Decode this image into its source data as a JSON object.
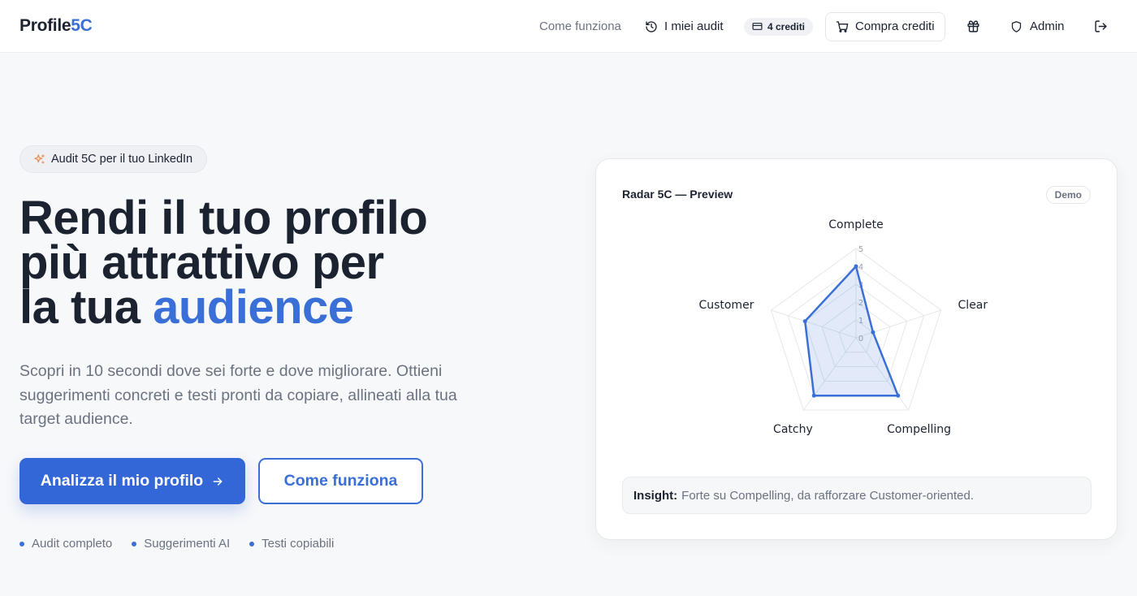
{
  "header": {
    "logo_main": "Profile",
    "logo_accent": "5C",
    "nav_how": "Come funziona",
    "nav_audits": "I miei audit",
    "credits": "4 crediti",
    "buy": "Compra crediti",
    "admin": "Admin"
  },
  "hero": {
    "pill": "Audit 5C per il tuo LinkedIn",
    "headline_line1": "Rendi il tuo profilo",
    "headline_line2": "più attrattivo per",
    "headline_line3_a": "la tua ",
    "headline_line3_b": "audience",
    "subtext": "Scopri in 10 secondi dove sei forte e dove migliorare. Ottieni suggerimenti concreti e testi pronti da copiare, allineati alla tua target audience.",
    "cta_primary": "Analizza il mio profilo",
    "cta_secondary": "Come funziona",
    "features": [
      "Audit completo",
      "Suggerimenti AI",
      "Testi copiabili"
    ]
  },
  "card": {
    "title": "Radar 5C — Preview",
    "badge": "Demo",
    "insight_label": "Insight:",
    "insight_text": "Forte su Compelling, da rafforzare Customer-oriented."
  },
  "chart_data": {
    "type": "radar",
    "axes": [
      "Complete",
      "Clear",
      "Compelling",
      "Catchy",
      "Customer"
    ],
    "ticks": [
      "0",
      "1",
      "2",
      "3",
      "4",
      "5"
    ],
    "range": [
      0,
      5
    ],
    "series": [
      {
        "values": [
          4,
          1,
          4,
          4,
          3
        ],
        "color": "#3a6fd8"
      }
    ]
  },
  "colors": {
    "accent": "#3a6fd8",
    "primary_button": "#3366d6"
  }
}
